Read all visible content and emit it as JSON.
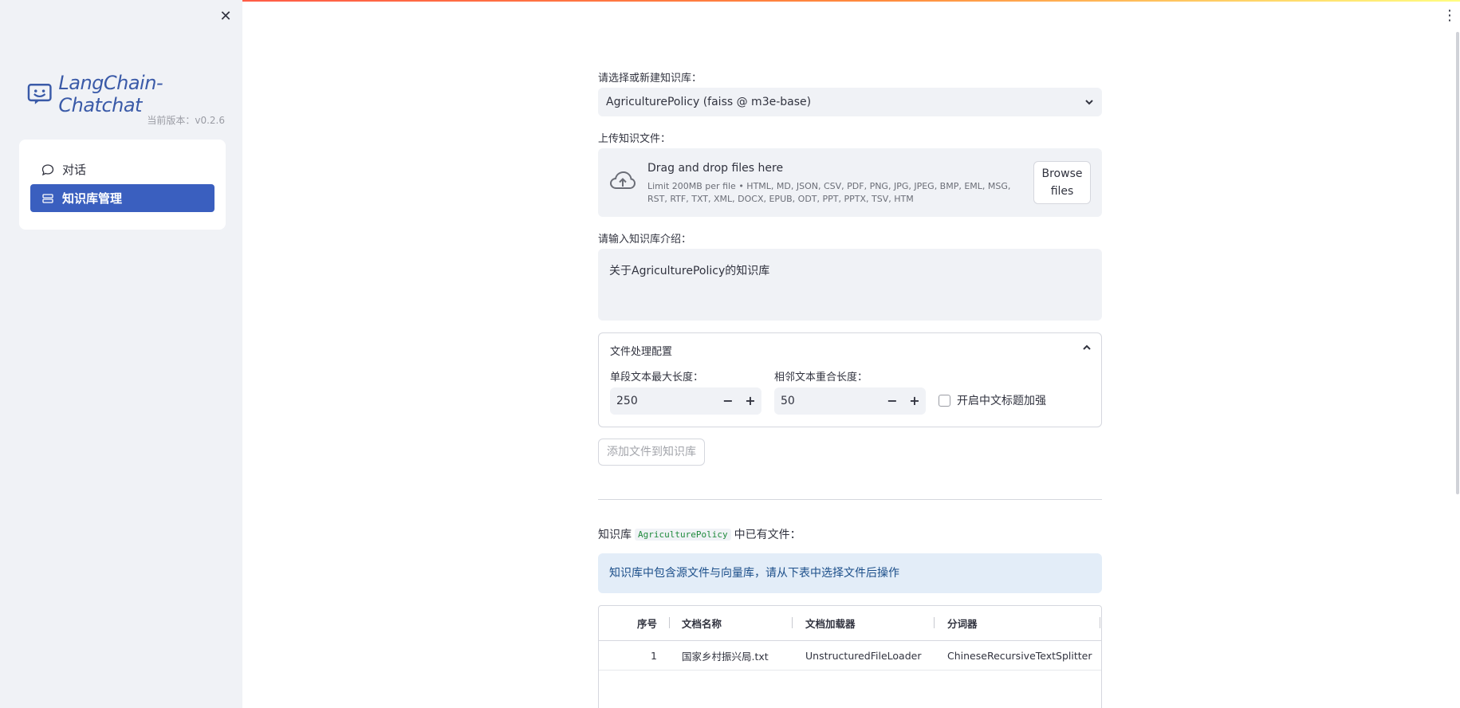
{
  "sidebar": {
    "close_label": "✕",
    "logo_text": "LangChain-Chatchat",
    "version": "当前版本：v0.2.6",
    "items": [
      {
        "label": "对话"
      },
      {
        "label": "知识库管理"
      }
    ]
  },
  "header": {
    "menu_label": "⋮"
  },
  "kb_select": {
    "label": "请选择或新建知识库：",
    "value": "AgriculturePolicy (faiss @ m3e-base)"
  },
  "upload": {
    "label": "上传知识文件：",
    "title": "Drag and drop files here",
    "limit": "Limit 200MB per file • HTML, MD, JSON, CSV, PDF, PNG, JPG, JPEG, BMP, EML, MSG, RST, RTF, TXT, XML, DOCX, EPUB, ODT, PPT, PPTX, TSV, HTM",
    "browse_line1": "Browse",
    "browse_line2": "files"
  },
  "intro": {
    "label": "请输入知识库介绍：",
    "value": "关于AgriculturePolicy的知识库"
  },
  "config": {
    "title": "文件处理配置",
    "chunk_size_label": "单段文本最大长度：",
    "chunk_size": "250",
    "overlap_label": "相邻文本重合长度：",
    "overlap": "50",
    "minus": "−",
    "plus": "+",
    "zh_title_label": "开启中文标题加强"
  },
  "add_button": "添加文件到知识库",
  "kb_files": {
    "title_prefix": "知识库",
    "kb_name": "AgriculturePolicy",
    "title_suffix": "中已有文件：",
    "info": "知识库中包含源文件与向量库，请从下表中选择文件后操作"
  },
  "table": {
    "headers": [
      "序号",
      "文档名称",
      "文档加载器",
      "分词器"
    ],
    "rows": [
      [
        "1",
        "国家乡村振兴局.txt",
        "UnstructuredFileLoader",
        "ChineseRecursiveTextSplitter"
      ]
    ]
  },
  "colors": {
    "accent": "#3a5fbf",
    "logo": "#3a5aa8",
    "info_bg": "#e3edf8"
  }
}
